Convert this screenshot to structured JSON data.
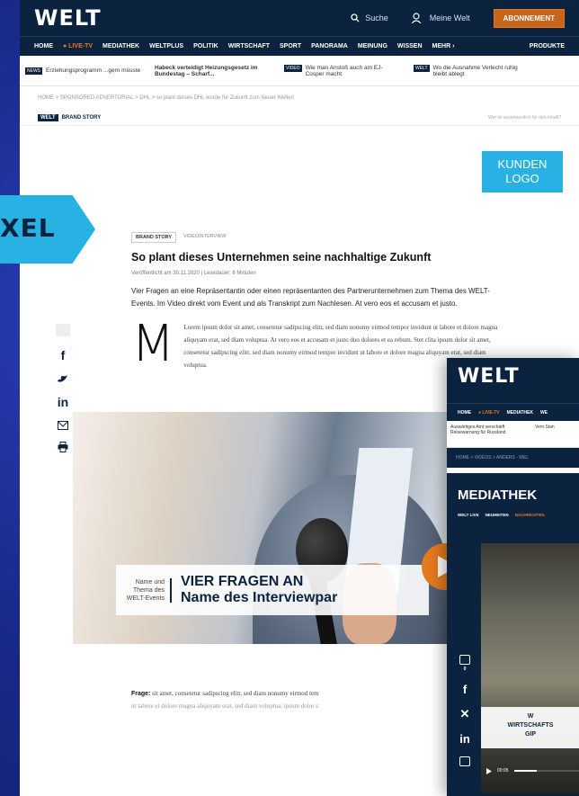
{
  "header": {
    "logo": "WELT",
    "search": "Suche",
    "account": "Meine Welt",
    "abo": "ABONNEMENT"
  },
  "nav": {
    "items": [
      "HOME",
      "● LIVE-TV",
      "MEDIATHEK",
      "WELTPLUS",
      "POLITIK",
      "WIRTSCHAFT",
      "SPORT",
      "PANORAMA",
      "MEINUNG",
      "WISSEN",
      "MEHR ›",
      "PRODUKTE"
    ]
  },
  "teasers": [
    {
      "badge": "NEWS",
      "text": "Erziehungsprogramm ...gern müsste"
    },
    {
      "badge": "",
      "text": "Habeck verteidigt Heizungsgesetz im Bundestag – Scharf..."
    },
    {
      "badge": "VIDEO",
      "text": "Wie man Anstoß auch am EJ-Cosper macht"
    },
    {
      "badge": "WELT",
      "text": "Wo die Ausnahme Verlecht ruhig bleibt ablegt"
    }
  ],
  "breadcrumb": "HOME > SPONSORED ADVERTORIAL > DHL > so plant dieses DHL wurde für Zukunft zum Neuer Welten",
  "brandbar": {
    "badge": "WELT",
    "label": "BRAND STORY",
    "notice": "Wer ist verantwortlich für den Inhalt?"
  },
  "kunden_logo": [
    "KUNDEN",
    "LOGO"
  ],
  "overlay_label": "XEL",
  "article": {
    "tag1": "BRAND STORY",
    "tag2": "VIDEOINTERVIEW",
    "title": "So plant dieses Unternehmen seine nachhaltige Zukunft",
    "meta": "Veröffentlicht am 30.11.2020 | Lesedauer: 6 Minuten",
    "intro": "Vier Fragen an eine Repräsentantin oder einen repräsentanten des Partnerunternehmen zum Thema des WELT-Events. Im Video direkt vom Event und als Transkript zum Nachlesen. At vero eos et accusam et justo.",
    "dropcap": "M",
    "body": "Lorem ipsum dolor sit amet, consetetur sadipscing elitr, sed diam nonumy eirmod tempor invidunt ut labore et dolore magna aliquyam erat, sed diam voluptua. At vero eos et accusam et justo duo dolores et ea rebum. Stet clita ipsum dolor sit amet, consetetur sadipscing elitr, sed diam nonumy eirmod tempor invidunt ut labore et dolore magna aliquyam erat, sed diam voluptua."
  },
  "hero": {
    "caption_small": "Name und Thema des WELT-Events",
    "caption_line1": "VIER FRAGEN AN",
    "caption_line2": "Name des Interviewpar"
  },
  "frage": {
    "label": "Frage:",
    "text": " sit amet, consetetur sadipscing elitr, sed diam nonumy eirmod tem",
    "text2": "ut labore et dolore magna aliquyam erat, sed diam voluptua. ipsum dolor s"
  },
  "mobile": {
    "logo": "WELT",
    "nav": [
      "HOME",
      "● LIVE-TV",
      "MEDIATHEK",
      "WE"
    ],
    "teasers": [
      "Auswärtiges Amt verschärft Reisewarnung für Russland",
      "Vem Stan"
    ],
    "breadcrumb": "HOME > VIDEOS > ANDERS - WEL",
    "title": "MEDIATHEK",
    "tabs": [
      "WELT LIVE",
      "NEUHEITEN",
      "NACHRICHTEN"
    ],
    "caption_line1": "W",
    "caption_line2": "WIRTSCHAFTS",
    "caption_line3": "GIP",
    "time": "00:05",
    "comment_count": "0",
    "progress": 0.35
  }
}
